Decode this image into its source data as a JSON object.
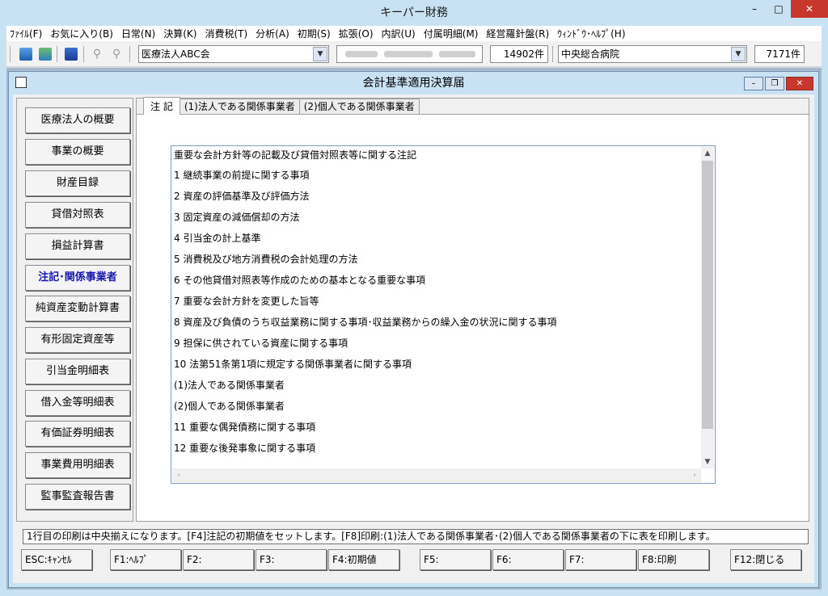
{
  "window": {
    "title": "キーパー財務"
  },
  "menu": [
    "ﾌｧｲﾙ(F)",
    "お気に入り(B)",
    "日常(N)",
    "決算(K)",
    "消費税(T)",
    "分析(A)",
    "初期(S)",
    "拡張(O)",
    "内訳(U)",
    "付属明細(M)",
    "経営羅針盤(R)",
    "ｳｨﾝﾄﾞｳ･ﾍﾙﾌﾟ(H)"
  ],
  "toolbar": {
    "company": "医療法人ABC会",
    "company_count": "14902件",
    "facility": "中央総合病院",
    "facility_count": "7171件"
  },
  "child": {
    "title": "会計基準適用決算届"
  },
  "nav": [
    "医療法人の概要",
    "事業の概要",
    "財産目録",
    "貸借対照表",
    "損益計算書",
    "注記･関係事業者",
    "純資産変動計算書",
    "有形固定資産等",
    "引当金明細表",
    "借入金等明細表",
    "有価証券明細表",
    "事業費用明細表",
    "監事監査報告書"
  ],
  "tabs": [
    "注 記",
    "(1)法人である関係事業者",
    "(2)個人である関係事業者"
  ],
  "notes": {
    "header": "重要な会計方針等の記載及び貸借対照表等に関する注記",
    "lines": [
      "1  継続事業の前提に関する事項",
      "2  資産の評価基準及び評価方法",
      "3  固定資産の減価償却の方法",
      "4  引当金の計上基準",
      "5  消費税及び地方消費税の会計処理の方法",
      "6  その他貸借対照表等作成のための基本となる重要な事項",
      "7  重要な会計方針を変更した旨等",
      "8  資産及び負債のうち収益業務に関する事項･収益業務からの繰入金の状況に関する事項",
      "9  担保に供されている資産に関する事項",
      "10  法第51条第1項に規定する関係事業者に関する事項",
      "(1)法人である関係事業者",
      "(2)個人である関係事業者",
      "11  重要な偶発債務に関する事項",
      "12  重要な後発事象に関する事項"
    ]
  },
  "status": "1行目の印刷は中央揃えになります。[F4]注記の初期値をセットします。[F8]印刷:(1)法人である関係事業者･(2)個人である関係事業者の下に表を印刷します。",
  "fkeys": [
    "ESC:ｷｬﾝｾﾙ",
    "F1:ﾍﾙﾌﾟ",
    "F2:",
    "F3:",
    "F4:初期値",
    "F5:",
    "F6:",
    "F7:",
    "F8:印刷",
    "F12:閉じる"
  ]
}
